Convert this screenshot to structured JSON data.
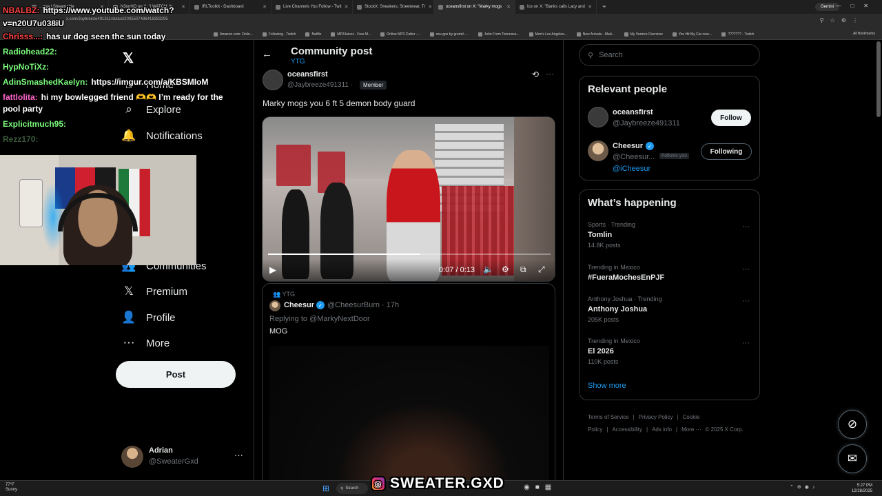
{
  "browser": {
    "tabs": [
      {
        "label": "...gga | Streamable"
      },
      {
        "label": "N3onHQ on X: \"| WATCH: N"
      },
      {
        "label": "IRLToolkit - Dashboard"
      },
      {
        "label": "Live Channels You Follow - Twit"
      },
      {
        "label": "StockX: Sneakers, Streetwear, Tr"
      },
      {
        "label": "oceansfirst on X: \"Marky mogs"
      },
      {
        "label": "Ice on X: \"Banks calls Lacy and"
      }
    ],
    "active_tab_index": 5,
    "gemini_label": "Gemini",
    "url": "x.com/Jaybreeze491311/status/2005507486418383295",
    "bookmarks": [
      "Amazon.com: Onlin...",
      "Following - Twitch",
      "Netflix",
      "MP3Juices - Free M...",
      "Online MP3 Cutter -...",
      "osu-pps by grumd -...",
      "John From Tennesse...",
      "Men's Los Angeles...",
      "New Arrivals - Mad...",
      "My Verizon Overview",
      "You Hit My Car reac...",
      "??????? - Twitch"
    ],
    "all_bookmarks": "All Bookmarks"
  },
  "nav": {
    "items": [
      {
        "label": "Home",
        "icon": "home-icon",
        "glyph": "⌂"
      },
      {
        "label": "Explore",
        "icon": "search-icon",
        "glyph": "⌕"
      },
      {
        "label": "Notifications",
        "icon": "bell-icon",
        "glyph": "🔔"
      },
      {
        "label": "Communities",
        "icon": "communities-icon",
        "glyph": "👥"
      },
      {
        "label": "Premium",
        "icon": "x-premium-icon",
        "glyph": "𝕏"
      },
      {
        "label": "Profile",
        "icon": "person-icon",
        "glyph": "👤"
      },
      {
        "label": "More",
        "icon": "more-circle-icon",
        "glyph": "⋯"
      }
    ],
    "post_label": "Post",
    "user": {
      "name": "Adrian",
      "handle": "@SweaterGxd"
    }
  },
  "header": {
    "title": "Community post",
    "subtitle": "YTG"
  },
  "post": {
    "author_name": "oceansfirst",
    "author_handle": "@Jaybreeze491311 ·",
    "badge": "Member",
    "text": "Marky mogs you 6 ft 5 demon body guard",
    "video": {
      "current": "0:07",
      "duration": "0:13",
      "progress": 0.54
    }
  },
  "reply": {
    "community": "YTG",
    "name": "Cheesur",
    "handle": "@CheesurBurn · 17h",
    "replying_to": "Replying to @MarkyNextDoor",
    "text": "MOG"
  },
  "sidebar": {
    "search_placeholder": "Search",
    "relevant_title": "Relevant people",
    "people": [
      {
        "name": "oceansfirst",
        "handle": "@Jaybreeze491311",
        "button": "Follow"
      },
      {
        "name": "Cheesur",
        "handle": "@Cheesur...",
        "follows_you": "Follows you",
        "button": "Following",
        "link": "@iCheesur"
      }
    ],
    "happening_title": "What’s happening",
    "trends": [
      {
        "meta": "Sports · Trending",
        "name": "Tomlin",
        "posts": "14.8K posts"
      },
      {
        "meta": "Trending in Mexico",
        "name": "#FueraMochesEnPJF",
        "posts": ""
      },
      {
        "meta": "Anthony Joshua · Trending",
        "name": "Anthony Joshua",
        "posts": "205K posts"
      },
      {
        "meta": "Trending in Mexico",
        "name": "El 2026",
        "posts": "110K posts"
      }
    ],
    "show_more": "Show more",
    "footer": [
      "Terms of Service",
      "|",
      "Privacy Policy",
      "|",
      "Cookie Policy",
      "|",
      "Accessibility",
      "|",
      "Ads info",
      "|",
      "More ···",
      "© 2025 X Corp."
    ]
  },
  "stream": {
    "chat": [
      {
        "user": "NBALBZ:",
        "color": "#ff4444",
        "msg": "https://www.youtube.com/watch?"
      },
      {
        "user": "",
        "color": "#ffffff",
        "msg": "v=n20U7u038iU"
      },
      {
        "user": "Chrisss...:",
        "color": "#ff4444",
        "msg": "has ur dog seen the sun today"
      },
      {
        "user": "Radiohead22:",
        "color": "#7cfc7c",
        "msg": ""
      },
      {
        "user": "HypNoTiXz:",
        "color": "#7cfc7c",
        "msg": ""
      },
      {
        "user": "AdinSmashedKaelyn:",
        "color": "#7cfc7c",
        "msg": "https://imgur.com/a/KBSMIoM"
      },
      {
        "user": "fattlolita:",
        "color": "#ff66cc",
        "msg": "hi my bowlegged friend 🫶🫶 I’m ready for the"
      },
      {
        "user": "",
        "color": "#ffffff",
        "msg": "pool party"
      },
      {
        "user": "Explicitmuch95:",
        "color": "#7cfc7c",
        "msg": ""
      },
      {
        "user": "Rezz170:",
        "color": "#3a5a3a",
        "msg": ""
      }
    ],
    "overlay_brand": "SWEATER.GXD"
  },
  "taskbar": {
    "weather_temp": "77°F",
    "weather_cond": "Sunny",
    "search": "Search",
    "time": "5:27 PM",
    "date": "12/28/2025"
  }
}
